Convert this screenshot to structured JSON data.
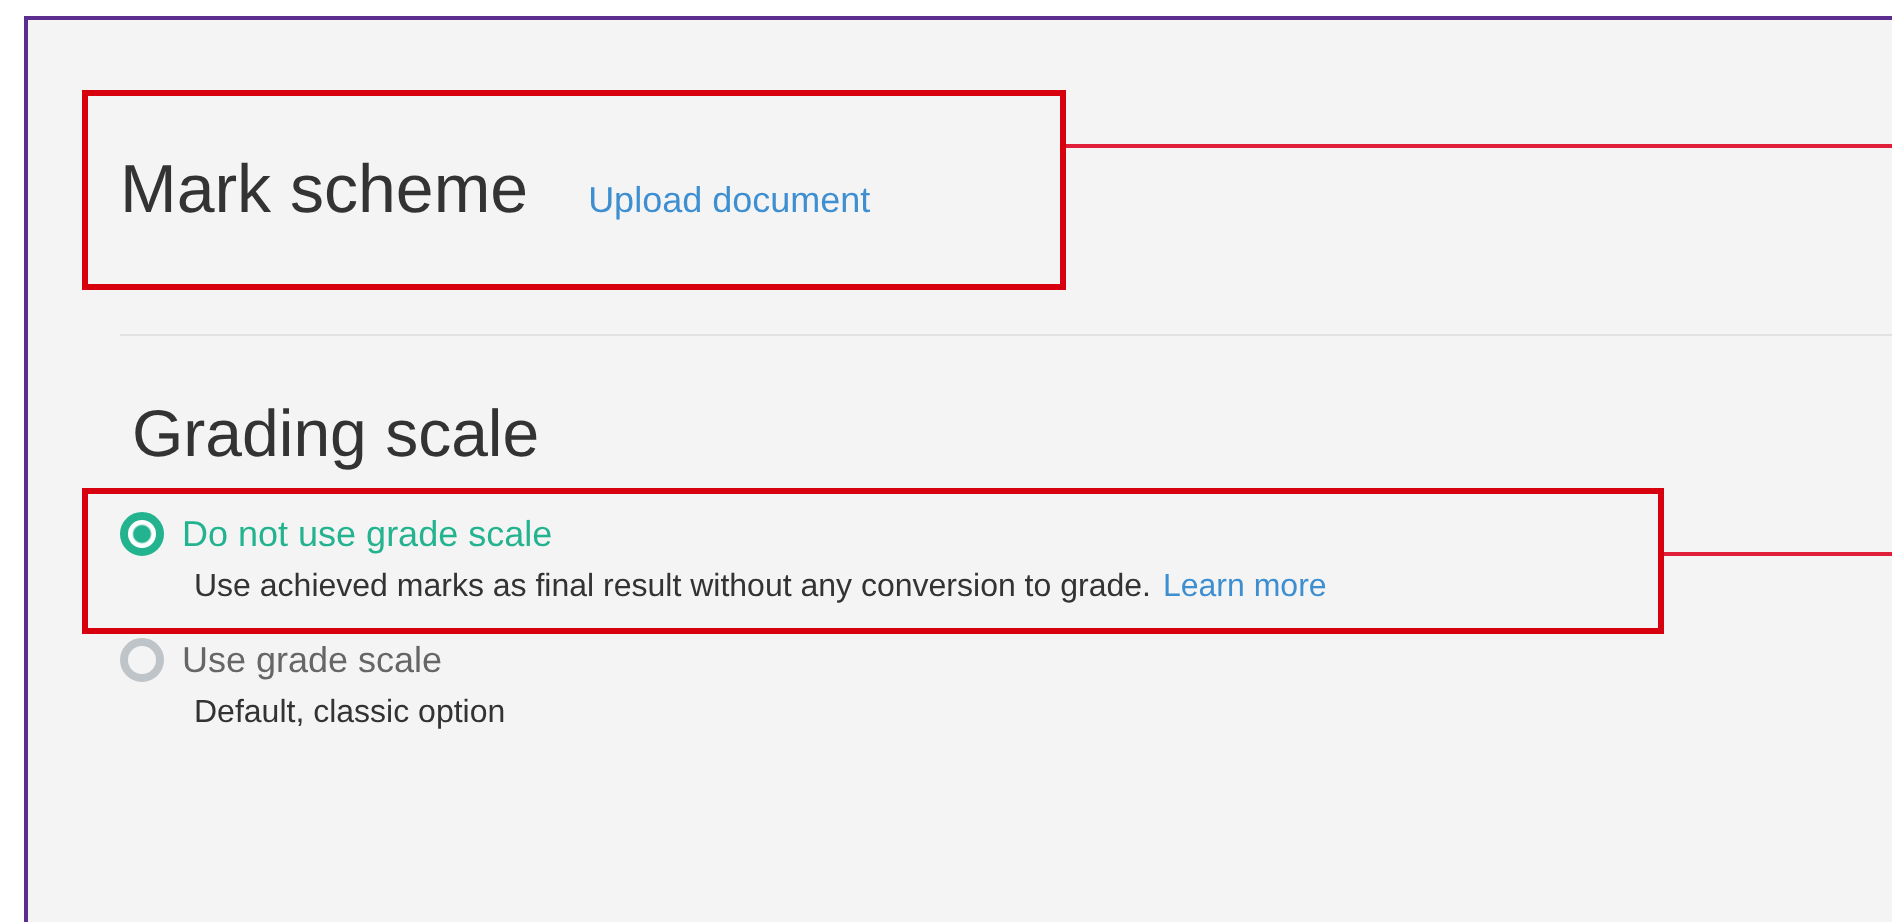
{
  "mark_scheme": {
    "title": "Mark scheme",
    "link": "Upload document",
    "highlighted": true
  },
  "grading_scale": {
    "title": "Grading scale",
    "options": [
      {
        "label": "Do not use grade scale",
        "description": "Use achieved marks as final result without any conversion to grade.",
        "link": "Learn more",
        "selected": true,
        "highlighted": true
      },
      {
        "label": "Use grade scale",
        "description": "Default, classic option",
        "selected": false,
        "highlighted": false
      }
    ]
  }
}
